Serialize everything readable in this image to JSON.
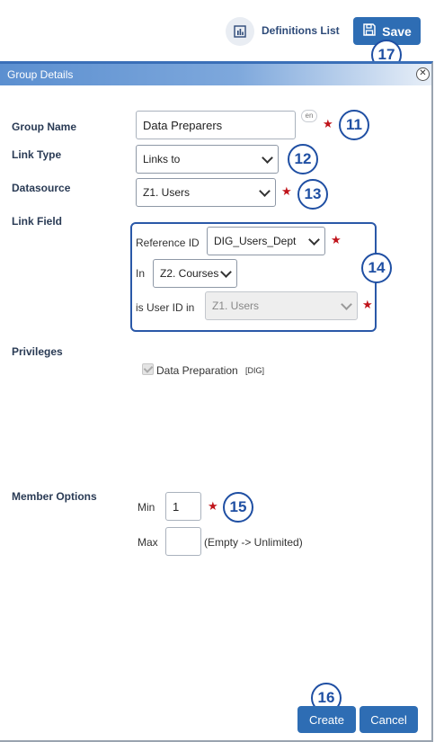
{
  "toolbar": {
    "definitions_label": "Definitions List",
    "definitions_icon": "bar-chart-icon",
    "save_label": "Save",
    "save_icon": "floppy-disk-icon"
  },
  "panel": {
    "title": "Group Details",
    "close_icon": "close-circle-icon"
  },
  "form": {
    "group_name": {
      "label": "Group Name",
      "value": "Data Preparers",
      "lang_badge": "en"
    },
    "link_type": {
      "label": "Link Type",
      "selected": "Links to"
    },
    "datasource": {
      "label": "Datasource",
      "selected": "Z1. Users"
    },
    "link_field": {
      "label": "Link Field",
      "reference_id_label": "Reference ID",
      "reference_id_selected": "DIG_Users_Dept",
      "in_label": "In",
      "in_selected": "Z2. Courses",
      "user_id_label": "is User ID in",
      "user_id_selected": "Z1. Users"
    },
    "privileges": {
      "label": "Privileges",
      "option_label": "Data Preparation",
      "option_tag": "[DIG]",
      "checked": true
    },
    "member_options": {
      "label": "Member Options",
      "min_label": "Min",
      "min_value": "1",
      "max_label": "Max",
      "max_value": "",
      "max_hint": "(Empty -> Unlimited)"
    }
  },
  "required_marker": "★",
  "buttons": {
    "create": "Create",
    "cancel": "Cancel"
  },
  "callouts": {
    "c11": "11",
    "c12": "12",
    "c13": "13",
    "c14": "14",
    "c15": "15",
    "c16": "16",
    "c17": "17"
  },
  "colors": {
    "accent": "#2e6db4",
    "callout": "#1f4fa3",
    "required": "#c0141b"
  }
}
